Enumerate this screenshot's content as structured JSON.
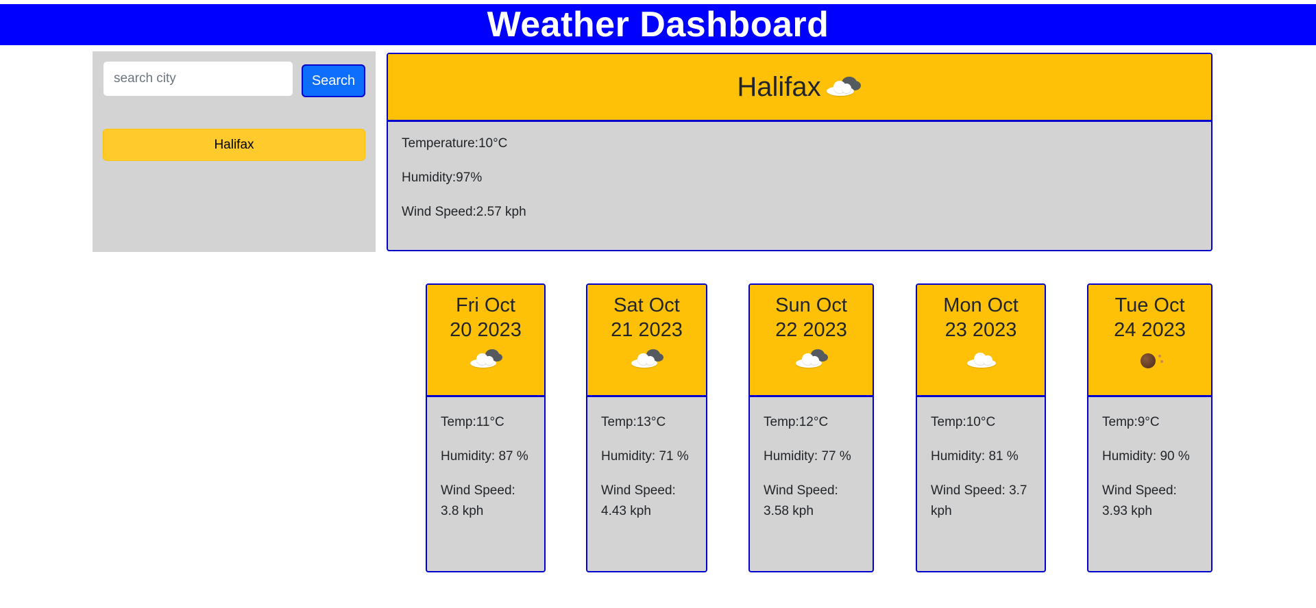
{
  "header": {
    "title": "Weather Dashboard"
  },
  "sidebar": {
    "search_placeholder": "search city",
    "search_button_label": "Search",
    "history": [
      "Halifax"
    ]
  },
  "current": {
    "city": "Halifax",
    "icon": "sun-behind-cloud-icon",
    "temperature": "Temperature:10°C",
    "humidity": "Humidity:97%",
    "wind": "Wind Speed:2.57 kph"
  },
  "forecast": [
    {
      "day": "Fri Oct",
      "date": "20 2023",
      "icon": "sun-behind-cloud-icon",
      "temp": "Temp:11°C",
      "humidity": "Humidity: 87 %",
      "wind": "Wind Speed: 3.8 kph"
    },
    {
      "day": "Sat Oct",
      "date": "21 2023",
      "icon": "sun-behind-cloud-icon",
      "temp": "Temp:13°C",
      "humidity": "Humidity: 71 %",
      "wind": "Wind Speed: 4.43 kph"
    },
    {
      "day": "Sun Oct",
      "date": "22 2023",
      "icon": "sun-behind-cloud-icon",
      "temp": "Temp:12°C",
      "humidity": "Humidity: 77 %",
      "wind": "Wind Speed: 3.58 kph"
    },
    {
      "day": "Mon Oct",
      "date": "23 2023",
      "icon": "cloud-icon",
      "temp": "Temp:10°C",
      "humidity": "Humidity: 81 %",
      "wind": "Wind Speed: 3.7 kph"
    },
    {
      "day": "Tue Oct",
      "date": "24 2023",
      "icon": "brown-dot-icon",
      "temp": "Temp:9°C",
      "humidity": "Humidity: 90 %",
      "wind": "Wind Speed: 3.93 kph"
    }
  ],
  "colors": {
    "banner": "#0000ff",
    "accent": "#ffc107",
    "panel": "#d3d3d3",
    "border": "#0000cc",
    "button": "#0d6efd"
  }
}
